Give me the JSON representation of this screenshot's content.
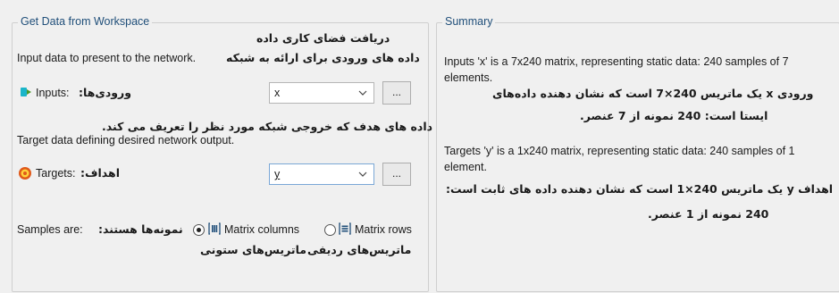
{
  "left_panel": {
    "title": "Get Data from Workspace",
    "fa_title": "دریافت فضای کاری داده",
    "input_desc": "Input data to present to the network.",
    "fa_input_desc": "داده های ورودی برای ارائه به شبکه",
    "inputs_label": "Inputs:",
    "fa_inputs_label": "ورودی‌ها:",
    "inputs_value": "x",
    "fa_target_desc": "داده های هدف که خروجی شبکه مورد نظر را تعریف می کند.",
    "target_desc": "Target data defining desired network output.",
    "targets_label": "Targets:",
    "fa_targets_label": "اهداف:",
    "targets_value": "y",
    "browse_label": "...",
    "samples_label": "Samples are:",
    "fa_samples_label": "نمونه‌ها هستند:",
    "matrix_columns": "Matrix columns",
    "matrix_rows": "Matrix rows",
    "fa_matrix_columns": "ماتریس‌های ستونی",
    "fa_matrix_rows": "ماتریس‌های ردیفی"
  },
  "summary": {
    "title": "Summary",
    "inputs_line1": "Inputs 'x' is a 7x240 matrix, representing static data: 240 samples of 7",
    "inputs_line2": "elements.",
    "fa_inputs_line1": "ورودی x یک ماتریس 240×7 است که نشان دهنده داده‌های",
    "fa_inputs_line2": "ایستا است: 240 نمونه از 7 عنصر.",
    "targets_line1": "Targets 'y' is a 1x240 matrix, representing static data: 240 samples of 1",
    "targets_line2": "element.",
    "fa_targets_line1": "اهداف y یک ماتریس 240×1 است که نشان دهنده داده های ثابت است:",
    "fa_targets_line2": "240  نمونه از 1 عنصر."
  },
  "colors": {
    "legend": "#1f4e79",
    "inputs_icon": "#1bb5c9",
    "targets_icon": "#e05a1a"
  }
}
